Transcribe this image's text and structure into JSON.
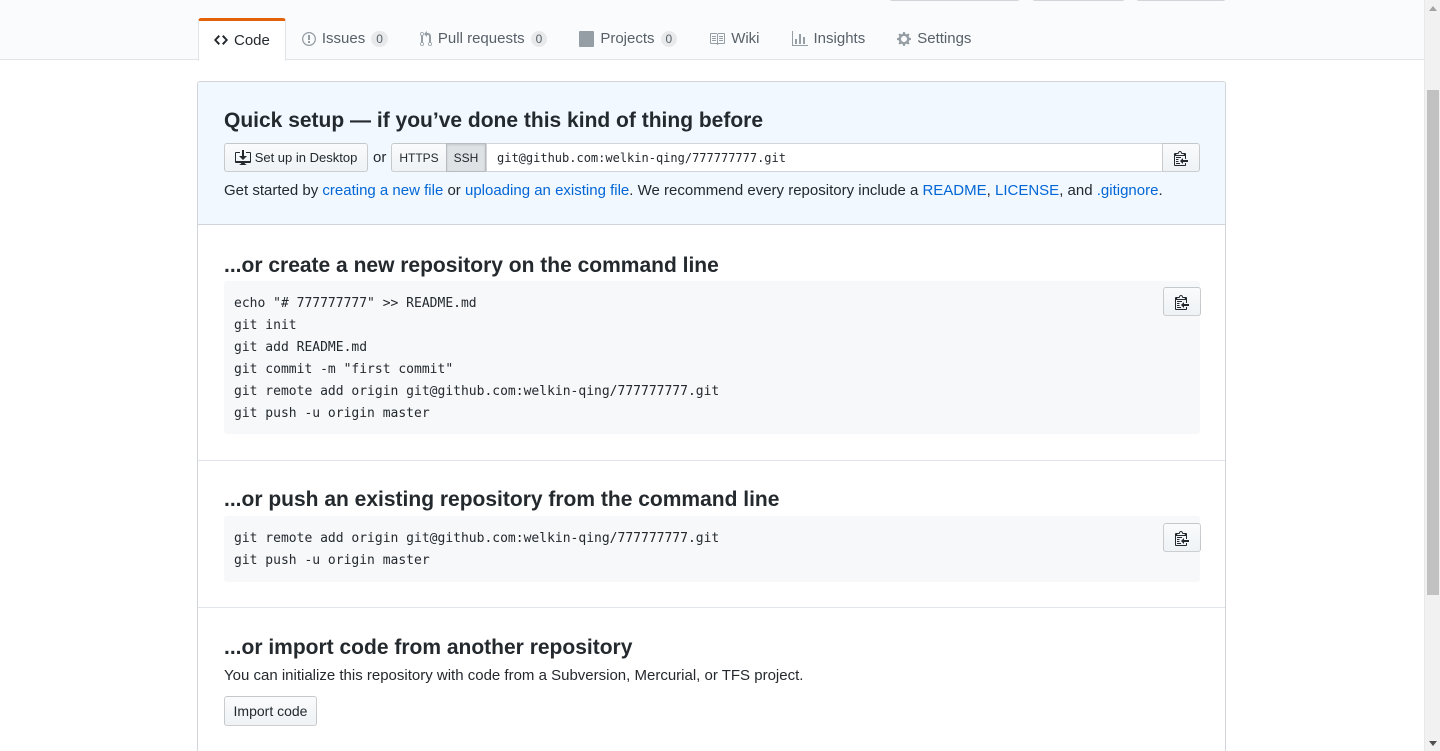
{
  "tabs": [
    {
      "label": "Code",
      "icon": "code-icon",
      "selected": true
    },
    {
      "label": "Issues",
      "icon": "issue-icon",
      "count": "0"
    },
    {
      "label": "Pull requests",
      "icon": "pull-request-icon",
      "count": "0"
    },
    {
      "label": "Projects",
      "icon": "project-icon",
      "count": "0"
    },
    {
      "label": "Wiki",
      "icon": "book-icon"
    },
    {
      "label": "Insights",
      "icon": "graph-icon"
    },
    {
      "label": "Settings",
      "icon": "gear-icon"
    }
  ],
  "quick_setup": {
    "title": "Quick setup — if you’ve done this kind of thing before",
    "desktop_button": "Set up in Desktop",
    "or_text": "or",
    "https_label": "HTTPS",
    "ssh_label": "SSH",
    "selected_protocol": "SSH",
    "url": "git@github.com:welkin-qing/777777777.git",
    "get_started": {
      "t1": "Get started by ",
      "link1": "creating a new file",
      "t2": " or ",
      "link2": "uploading an existing file",
      "t3": ". We recommend every repository include a ",
      "link3": "README",
      "t4": ", ",
      "link4": "LICENSE",
      "t5": ", and ",
      "link5": ".gitignore",
      "t6": "."
    }
  },
  "new_repo": {
    "title": "...or create a new repository on the command line",
    "lines": [
      "echo \"# 777777777\" >> README.md",
      "git init",
      "git add README.md",
      "git commit -m \"first commit\"",
      "git remote add origin git@github.com:welkin-qing/777777777.git",
      "git push -u origin master"
    ]
  },
  "push_repo": {
    "title": "...or push an existing repository from the command line",
    "lines": [
      "git remote add origin git@github.com:welkin-qing/777777777.git",
      "git push -u origin master"
    ]
  },
  "import_repo": {
    "title": "...or import code from another repository",
    "description": "You can initialize this repository with code from a Subversion, Mercurial, or TFS project.",
    "button": "Import code"
  },
  "colors": {
    "link": "#0366d6",
    "selected_tab_border": "#e36209",
    "quick_setup_bg": "#f1f8ff"
  }
}
